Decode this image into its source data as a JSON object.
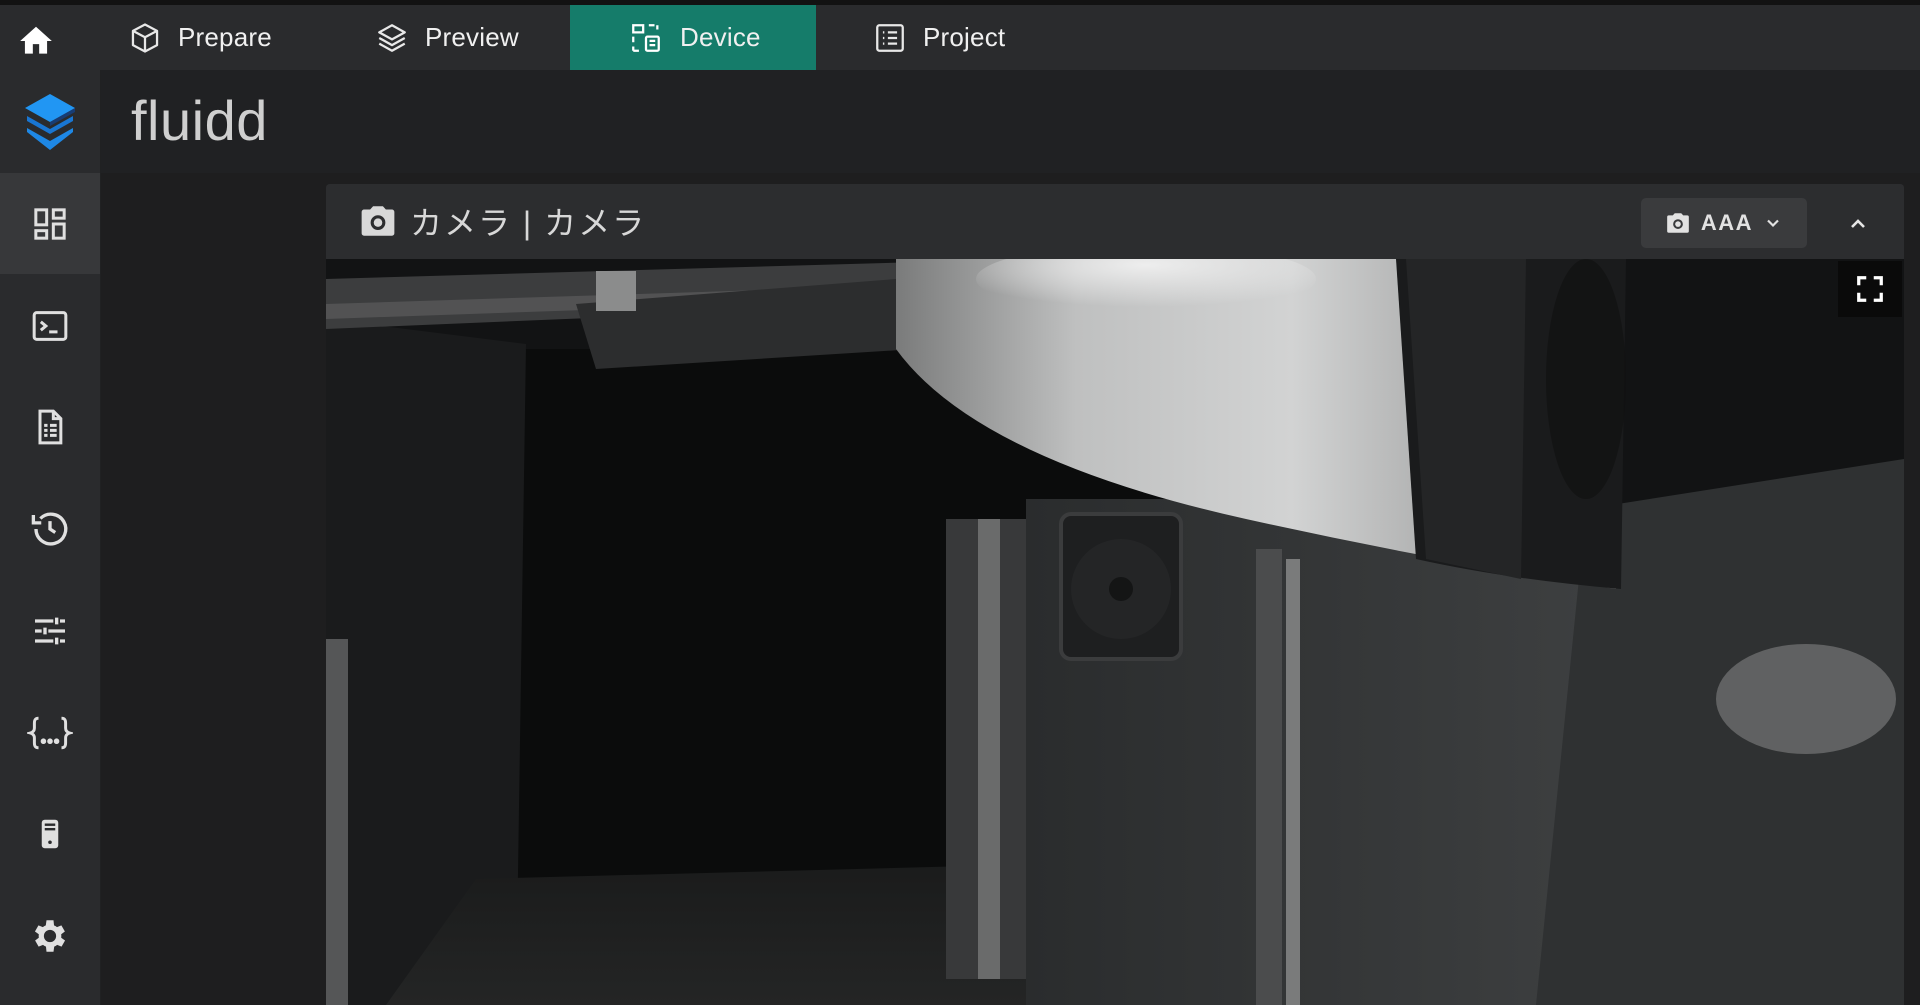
{
  "tabs": [
    {
      "label": "Prepare",
      "icon": "cube-icon",
      "active": false
    },
    {
      "label": "Preview",
      "icon": "layers-icon",
      "active": false
    },
    {
      "label": "Device",
      "icon": "device-icon",
      "active": true
    },
    {
      "label": "Project",
      "icon": "list-icon",
      "active": false
    }
  ],
  "header": {
    "brand": "fluidd"
  },
  "sidebar": {
    "items": [
      {
        "icon": "dashboard-icon",
        "active": true
      },
      {
        "icon": "console-icon",
        "active": false
      },
      {
        "icon": "file-icon",
        "active": false
      },
      {
        "icon": "history-icon",
        "active": false
      },
      {
        "icon": "tune-icon",
        "active": false
      },
      {
        "icon": "macros-icon",
        "active": false
      },
      {
        "icon": "device-icon",
        "active": false
      },
      {
        "icon": "settings-icon",
        "active": false
      }
    ]
  },
  "camera_card": {
    "title": "カメラ | カメラ",
    "selected_camera": "AAA"
  },
  "colors": {
    "accent": "#157c6a",
    "logo_blue": "#1e88e5",
    "topbar": "#2a2b2d",
    "card": "#2c2d2f"
  }
}
